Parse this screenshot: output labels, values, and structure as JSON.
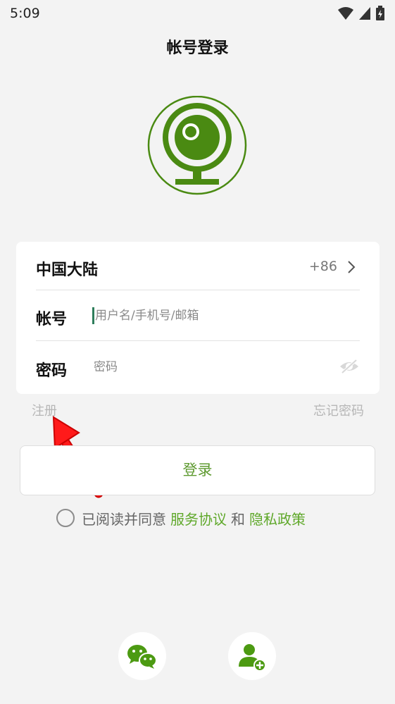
{
  "status_bar": {
    "time": "5:09"
  },
  "page": {
    "title": "帐号登录"
  },
  "form": {
    "region_label": "中国大陆",
    "country_code": "+86",
    "account_label": "帐号",
    "account_placeholder": "用户名/手机号/邮箱",
    "password_label": "密码",
    "password_placeholder": "密码"
  },
  "links": {
    "register": "注册",
    "forgot_password": "忘记密码"
  },
  "login_button": "登录",
  "agreement": {
    "prefix": "已阅读并同意",
    "service": "服务协议",
    "and": "和",
    "privacy": "隐私政策"
  },
  "colors": {
    "accent": "#4a8a12",
    "link_green": "#5fa82a",
    "background": "#f3f3f3"
  },
  "icons": [
    "wifi-icon",
    "signal-icon",
    "battery-icon",
    "webcam-logo-icon",
    "chevron-right-icon",
    "eye-hidden-icon",
    "wechat-icon",
    "add-user-icon"
  ]
}
